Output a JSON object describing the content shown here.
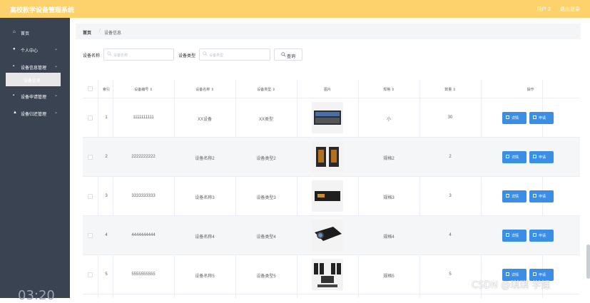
{
  "header": {
    "title": "高校教学设备管理系统",
    "user": "用户 2",
    "logout": "退出登录"
  },
  "sidebar": {
    "items": [
      {
        "label": "首页",
        "icon": "home-icon"
      },
      {
        "label": "个人中心",
        "icon": "user-icon"
      },
      {
        "label": "设备信息管理",
        "icon": "grid-icon"
      },
      {
        "label": "设备申请管理",
        "icon": "grid-icon"
      },
      {
        "label": "设备归还管理",
        "icon": "bank-icon"
      }
    ],
    "sub_item": "设备信息",
    "clock": "03:20"
  },
  "breadcrumb": {
    "home": "首页",
    "sep": "/",
    "current": "设备信息"
  },
  "search": {
    "name_label": "设备名称",
    "name_placeholder": "设备名称",
    "type_label": "设备类型",
    "type_placeholder": "设备类型",
    "button": "查询"
  },
  "table": {
    "headers": [
      "索引",
      "设备编号",
      "设备名称",
      "设备类型",
      "图片",
      "规格",
      "数量",
      "操作"
    ],
    "rows": [
      {
        "index": "1",
        "code": "1111111111",
        "name": "XX设备",
        "type": "XX类型",
        "spec": "小",
        "qty": "30"
      },
      {
        "index": "2",
        "code": "2222222222",
        "name": "设备名称2",
        "type": "设备类型2",
        "spec": "规格2",
        "qty": "2"
      },
      {
        "index": "3",
        "code": "3333333333",
        "name": "设备名称3",
        "type": "设备类型3",
        "spec": "规格3",
        "qty": "3"
      },
      {
        "index": "4",
        "code": "4444444444",
        "name": "设备名称4",
        "type": "设备类型4",
        "spec": "规格4",
        "qty": "4"
      },
      {
        "index": "5",
        "code": "5555555555",
        "name": "设备名称5",
        "type": "设备类型5",
        "spec": "规格5",
        "qty": "5"
      }
    ],
    "detail_btn": "详情",
    "apply_btn": "申请"
  },
  "watermark": "CSDN @琪琪 学姐",
  "colors": {
    "topbar": "#fdd26c",
    "sidebar": "#394352",
    "button": "#3a8ee6"
  }
}
